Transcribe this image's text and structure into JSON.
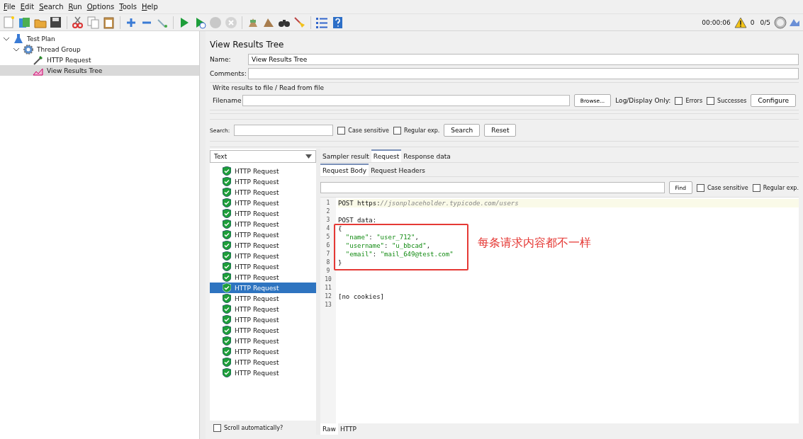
{
  "menu": [
    "File",
    "Edit",
    "Search",
    "Run",
    "Options",
    "Tools",
    "Help"
  ],
  "status": {
    "elapsed": "00:00:06",
    "warnings": "0",
    "threads": "0/5"
  },
  "tree": [
    {
      "label": "Test Plan",
      "kind": "plan",
      "expanded": true,
      "selected": false,
      "children": [
        {
          "label": "Thread Group",
          "kind": "group",
          "expanded": true,
          "selected": false,
          "children": [
            {
              "label": "HTTP Request",
              "kind": "sampler",
              "selected": false
            },
            {
              "label": "View Results Tree",
              "kind": "listener",
              "selected": true
            }
          ]
        }
      ]
    }
  ],
  "panel": {
    "title": "View Results Tree",
    "name_label": "Name:",
    "name_value": "View Results Tree",
    "comments_label": "Comments:",
    "file_group": "Write results to file / Read from file",
    "filename_label": "Filename",
    "browse": "Browse...",
    "log_label": "Log/Display Only:",
    "errors": {
      "label": "Errors",
      "checked": false
    },
    "successes": {
      "label": "Successes",
      "checked": false
    },
    "configure": "Configure"
  },
  "search": {
    "label": "Search:",
    "case_sensitive": {
      "label": "Case sensitive",
      "checked": false
    },
    "regex": {
      "label": "Regular exp.",
      "checked": false
    },
    "search_button": "Search",
    "reset_button": "Reset"
  },
  "renderer": "Text",
  "results": [
    {
      "label": "HTTP Request",
      "selected": false
    },
    {
      "label": "HTTP Request",
      "selected": false
    },
    {
      "label": "HTTP Request",
      "selected": false
    },
    {
      "label": "HTTP Request",
      "selected": false
    },
    {
      "label": "HTTP Request",
      "selected": false
    },
    {
      "label": "HTTP Request",
      "selected": false
    },
    {
      "label": "HTTP Request",
      "selected": false
    },
    {
      "label": "HTTP Request",
      "selected": false
    },
    {
      "label": "HTTP Request",
      "selected": false
    },
    {
      "label": "HTTP Request",
      "selected": false
    },
    {
      "label": "HTTP Request",
      "selected": false
    },
    {
      "label": "HTTP Request",
      "selected": true
    },
    {
      "label": "HTTP Request",
      "selected": false
    },
    {
      "label": "HTTP Request",
      "selected": false
    },
    {
      "label": "HTTP Request",
      "selected": false
    },
    {
      "label": "HTTP Request",
      "selected": false
    },
    {
      "label": "HTTP Request",
      "selected": false
    },
    {
      "label": "HTTP Request",
      "selected": false
    },
    {
      "label": "HTTP Request",
      "selected": false
    },
    {
      "label": "HTTP Request",
      "selected": false
    }
  ],
  "scroll_auto": {
    "label": "Scroll automatically?",
    "checked": false
  },
  "tabs": [
    {
      "label": "Sampler result",
      "selected": false
    },
    {
      "label": "Request",
      "selected": true
    },
    {
      "label": "Response data",
      "selected": false
    }
  ],
  "subtabs": [
    {
      "label": "Request Body",
      "selected": true
    },
    {
      "label": "Request Headers",
      "selected": false
    }
  ],
  "find": {
    "button": "Find",
    "case_sensitive": {
      "label": "Case sensitive",
      "checked": false
    },
    "regex": {
      "label": "Regular exp.",
      "checked": false
    }
  },
  "code": [
    {
      "number": "1",
      "segments": [
        {
          "text": "POST https:",
          "kind": "plain"
        },
        {
          "text": "//jsonplaceholder.typicode.com/users",
          "kind": "comment"
        }
      ]
    },
    {
      "number": "2"
    },
    {
      "number": "3",
      "segments": [
        {
          "text": "POST data:",
          "kind": "plain"
        }
      ]
    },
    {
      "number": "4",
      "segments": [
        {
          "text": "{",
          "kind": "plain"
        }
      ]
    },
    {
      "number": "5",
      "segments": [
        {
          "text": "  \"name\"",
          "kind": "string"
        },
        {
          "text": ": ",
          "kind": "plain"
        },
        {
          "text": "\"user_712\"",
          "kind": "string"
        },
        {
          "text": ",",
          "kind": "plain"
        }
      ]
    },
    {
      "number": "6",
      "segments": [
        {
          "text": "  \"username\"",
          "kind": "string"
        },
        {
          "text": ": ",
          "kind": "plain"
        },
        {
          "text": "\"u_bbcad\"",
          "kind": "string"
        },
        {
          "text": ",",
          "kind": "plain"
        }
      ]
    },
    {
      "number": "7",
      "segments": [
        {
          "text": "  \"email\"",
          "kind": "string"
        },
        {
          "text": ": ",
          "kind": "plain"
        },
        {
          "text": "\"mail_649@test.com\"",
          "kind": "string"
        }
      ]
    },
    {
      "number": "8",
      "segments": [
        {
          "text": "}",
          "kind": "plain"
        }
      ]
    },
    {
      "number": "9"
    },
    {
      "number": "10"
    },
    {
      "number": "11"
    },
    {
      "number": "12",
      "segments": [
        {
          "text": "[no cookies]",
          "kind": "plain"
        }
      ]
    },
    {
      "number": "13"
    }
  ],
  "annotation": "每条请求内容都不一样",
  "bottom_tabs": [
    {
      "label": "Raw",
      "selected": true
    },
    {
      "label": "HTTP",
      "selected": false
    }
  ]
}
